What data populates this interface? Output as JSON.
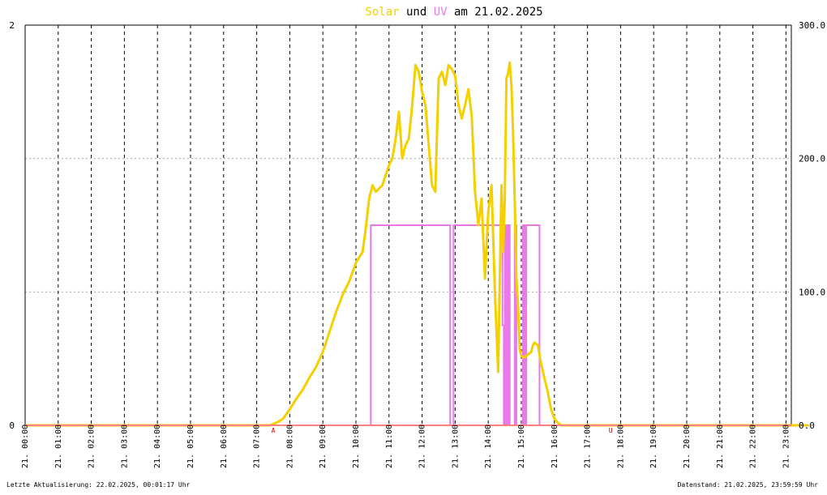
{
  "title": {
    "part_solar": "Solar",
    "part_und": " und ",
    "part_uv": "UV",
    "part_date": " am 21.02.2025"
  },
  "colors": {
    "solar": "#f5d000",
    "uv": "#e878e8",
    "title_text": "#000000",
    "grid_major": "#000000",
    "grid_minor": "#aaaaaa",
    "baseline": "#ff8080",
    "marker": "#cc0000"
  },
  "footer": {
    "left": "Letzte Aktualisierung: 22.02.2025, 00:01:17 Uhr",
    "right": "Datenstand: 21.02.2025, 23:59:59 Uhr"
  },
  "chart_data": {
    "type": "line",
    "x_unit": "hour",
    "xlim": [
      0,
      23.7
    ],
    "x_ticks": [
      {
        "x": 0,
        "label": "21. 00:00"
      },
      {
        "x": 1,
        "label": "21. 01:00"
      },
      {
        "x": 2,
        "label": "21. 02:00"
      },
      {
        "x": 3,
        "label": "21. 03:00"
      },
      {
        "x": 4,
        "label": "21. 04:00"
      },
      {
        "x": 5,
        "label": "21. 05:00"
      },
      {
        "x": 6,
        "label": "21. 06:00"
      },
      {
        "x": 7,
        "label": "21. 07:00"
      },
      {
        "x": 8,
        "label": "21. 08:00"
      },
      {
        "x": 9,
        "label": "21. 09:00"
      },
      {
        "x": 10,
        "label": "21. 10:00"
      },
      {
        "x": 11,
        "label": "21. 11:00"
      },
      {
        "x": 12,
        "label": "21. 12:00"
      },
      {
        "x": 13,
        "label": "21. 13:00"
      },
      {
        "x": 14,
        "label": "21. 14:00"
      },
      {
        "x": 15,
        "label": "21. 15:00"
      },
      {
        "x": 16,
        "label": "21. 16:00"
      },
      {
        "x": 17,
        "label": "21. 17:00"
      },
      {
        "x": 18,
        "label": "21. 18:00"
      },
      {
        "x": 19,
        "label": "21. 19:00"
      },
      {
        "x": 20,
        "label": "21. 20:00"
      },
      {
        "x": 21,
        "label": "21. 21:00"
      },
      {
        "x": 22,
        "label": "21. 22:00"
      },
      {
        "x": 23,
        "label": "21. 23:00"
      }
    ],
    "left_axis": {
      "ylim": [
        0,
        2
      ],
      "ticks": [
        {
          "v": 0,
          "label": "0"
        },
        {
          "v": 2,
          "label": "2"
        }
      ]
    },
    "right_axis": {
      "ylim": [
        0,
        300
      ],
      "ticks": [
        {
          "v": 0,
          "label": "0.0"
        },
        {
          "v": 100,
          "label": "100.0"
        },
        {
          "v": 200,
          "label": "200.0"
        },
        {
          "v": 300,
          "label": "300.0"
        }
      ]
    },
    "grid_minor_right_values": [
      100,
      200
    ],
    "markers": [
      {
        "x": 7.5,
        "label": "A"
      },
      {
        "x": 17.7,
        "label": "U"
      }
    ],
    "series": [
      {
        "name": "Solar",
        "axis": "right",
        "x": [
          0,
          7.4,
          7.6,
          7.8,
          8.0,
          8.2,
          8.4,
          8.6,
          8.8,
          9.0,
          9.2,
          9.4,
          9.6,
          9.8,
          10.0,
          10.2,
          10.3,
          10.4,
          10.5,
          10.6,
          10.8,
          11.0,
          11.1,
          11.2,
          11.3,
          11.4,
          11.5,
          11.6,
          11.7,
          11.8,
          11.9,
          12.0,
          12.1,
          12.2,
          12.3,
          12.4,
          12.5,
          12.6,
          12.7,
          12.8,
          12.9,
          13.0,
          13.1,
          13.2,
          13.3,
          13.4,
          13.5,
          13.6,
          13.7,
          13.8,
          13.9,
          14.0,
          14.1,
          14.2,
          14.3,
          14.4,
          14.45,
          14.5,
          14.55,
          14.6,
          14.65,
          14.7,
          14.75,
          14.8,
          14.85,
          14.9,
          14.95,
          15.0,
          15.05,
          15.1,
          15.2,
          15.3,
          15.35,
          15.4,
          15.5,
          15.6,
          15.7,
          15.8,
          15.9,
          16.0,
          16.1,
          16.2,
          16.3,
          16.4,
          16.5,
          16.6,
          16.7,
          16.8,
          16.9,
          17.0,
          17.1,
          17.2,
          17.3,
          17.4,
          17.5,
          17.6,
          17.8,
          23.7
        ],
        "values": [
          0,
          0,
          2,
          5,
          12,
          20,
          27,
          36,
          44,
          55,
          70,
          85,
          98,
          108,
          122,
          130,
          148,
          170,
          180,
          175,
          180,
          195,
          200,
          215,
          235,
          200,
          210,
          215,
          240,
          270,
          265,
          250,
          240,
          210,
          180,
          175,
          260,
          265,
          255,
          270,
          267,
          262,
          240,
          230,
          240,
          252,
          232,
          175,
          150,
          170,
          110,
          160,
          180,
          100,
          40,
          180,
          130,
          170,
          260,
          264,
          272,
          255,
          220,
          170,
          110,
          90,
          57,
          52,
          51,
          51,
          53,
          55,
          60,
          62,
          60,
          46,
          35,
          25,
          12,
          5,
          2,
          0,
          0,
          0,
          0,
          0,
          0,
          0,
          0,
          0,
          0,
          0,
          0,
          0,
          0,
          0,
          0,
          0
        ]
      },
      {
        "name": "UV",
        "axis": "left",
        "step": true,
        "x": [
          0,
          10.4,
          10.45,
          12.8,
          12.85,
          12.9,
          12.95,
          14.4,
          14.43,
          14.47,
          14.5,
          14.55,
          14.6,
          14.65,
          14.75,
          14.8,
          14.85,
          15.05,
          15.1,
          15.15,
          15.5,
          15.55,
          23.7
        ],
        "values": [
          0,
          0,
          1,
          1,
          0,
          0,
          1,
          1,
          0.5,
          0,
          1,
          0,
          1,
          0,
          0,
          1,
          0,
          1,
          0,
          1,
          1,
          0,
          0
        ]
      }
    ]
  }
}
